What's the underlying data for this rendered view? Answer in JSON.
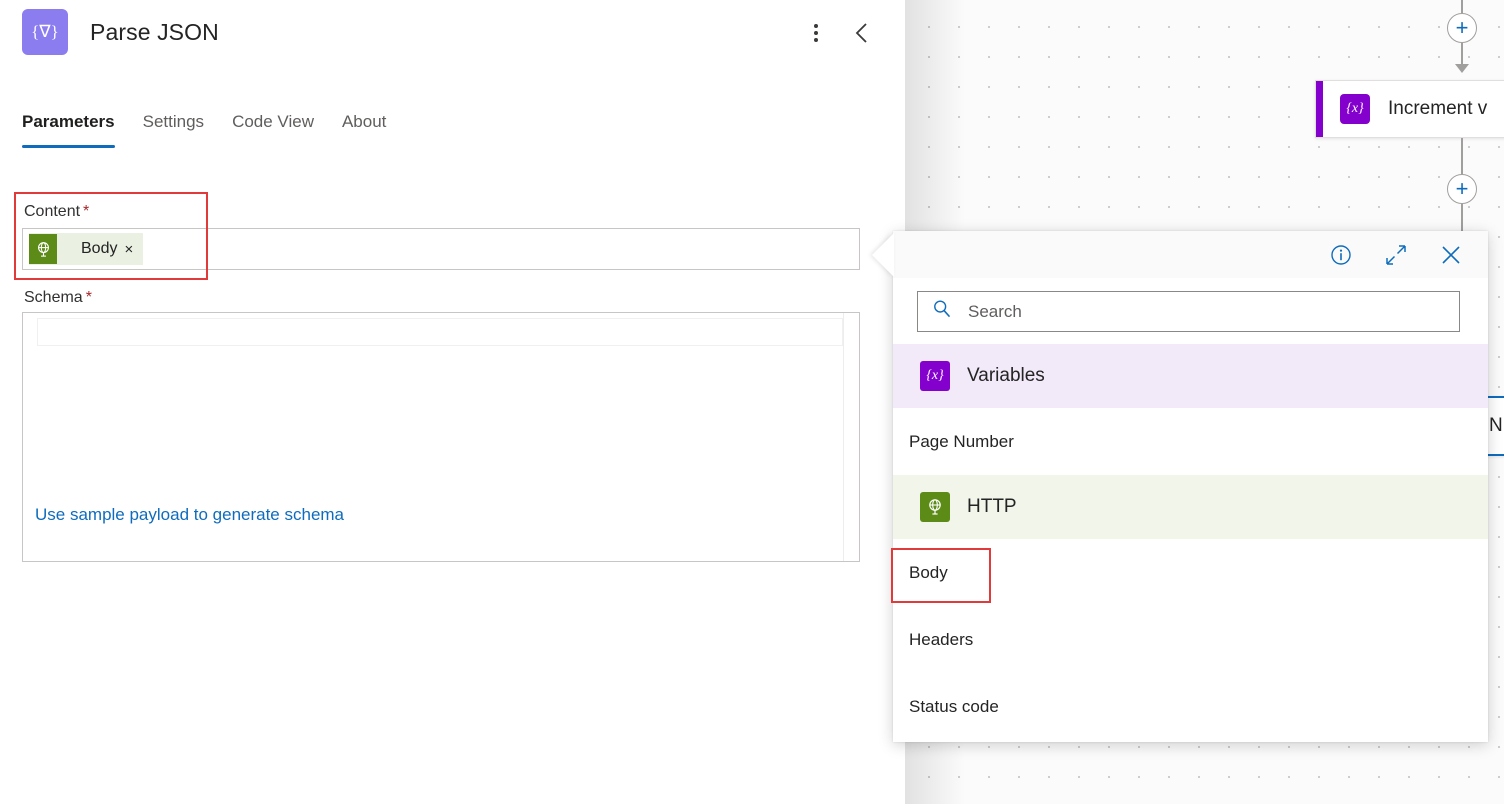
{
  "header": {
    "title": "Parse JSON",
    "icon": "parse-json-icon",
    "icon_glyph": "{∇}",
    "icon_color": "#8b7cf0",
    "more_label": "⋮",
    "collapse_label": "‹"
  },
  "tabs": [
    {
      "label": "Parameters",
      "active": true
    },
    {
      "label": "Settings",
      "active": false
    },
    {
      "label": "Code View",
      "active": false
    },
    {
      "label": "About",
      "active": false
    }
  ],
  "fields": {
    "content": {
      "label": "Content",
      "required_marker": "*",
      "token": {
        "label": "Body",
        "remove": "×",
        "icon": "http-globe-icon",
        "icon_color": "#5d8b18",
        "chip_color": "#eaf0e2"
      }
    },
    "schema": {
      "label": "Schema",
      "required_marker": "*",
      "value": "",
      "generate_link": "Use sample payload to generate schema",
      "link_color": "#0f6cbd"
    }
  },
  "dynamic_content": {
    "toolbar": {
      "info_label": "i",
      "expand_label": "⤡",
      "close_label": "✕"
    },
    "search": {
      "placeholder": "Search",
      "value": "",
      "icon": "search-icon"
    },
    "groups": [
      {
        "name": "Variables",
        "icon_glyph": "{x}",
        "icon_color": "#8400cd",
        "bg": "#f2eaf9",
        "items": [
          "Page Number"
        ]
      },
      {
        "name": "HTTP",
        "icon_glyph": "♁",
        "icon_color": "#5d8b18",
        "bg": "#f1f5ea",
        "items": [
          "Body",
          "Headers",
          "Status code"
        ]
      }
    ]
  },
  "canvas": {
    "cards": [
      {
        "name": "Increment v",
        "icon_glyph": "{x}",
        "accent": "#8400cd"
      }
    ],
    "selected_card": {
      "name": "N"
    },
    "add_button_label": "+"
  },
  "annotations": [
    {
      "target": "content-field"
    },
    {
      "target": "dynamic-content-body-item"
    }
  ]
}
